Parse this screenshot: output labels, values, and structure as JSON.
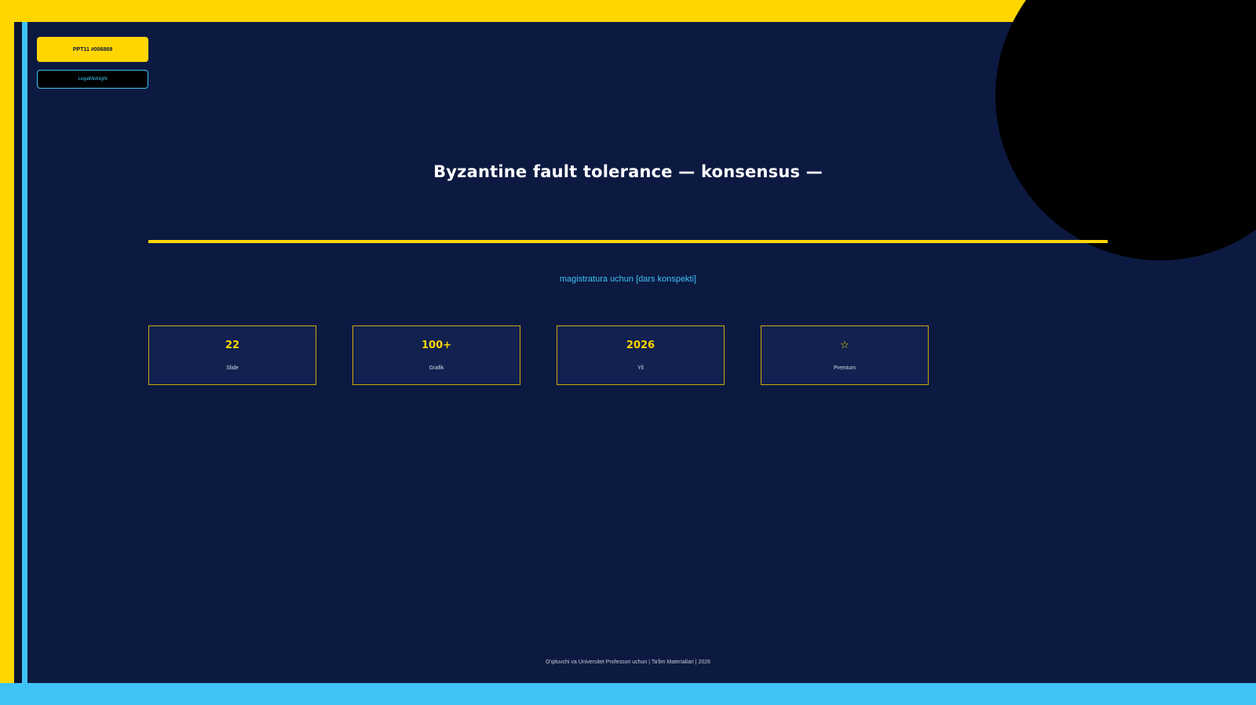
{
  "slide": {
    "badge": "PPT11 #006869",
    "tag": "LegalMidnight",
    "title": "Byzantine fault tolerance — konsensus —",
    "subtitle": "magistratura uchun [dars konspekti]",
    "stats": [
      {
        "value": "22",
        "label": "Slide"
      },
      {
        "value": "100+",
        "label": "Grafik"
      },
      {
        "value": "2026",
        "label": "Yil"
      },
      {
        "value": "☆",
        "label": "Premium"
      }
    ],
    "footer": "O'qituvchi va Universitet Professori uchun | Ta'lim Materiallari | 2026"
  },
  "colors": {
    "background": "#0c1a42",
    "accent_yellow": "#ffd600",
    "accent_blue": "#3fc3f5",
    "circle": "#000000"
  }
}
